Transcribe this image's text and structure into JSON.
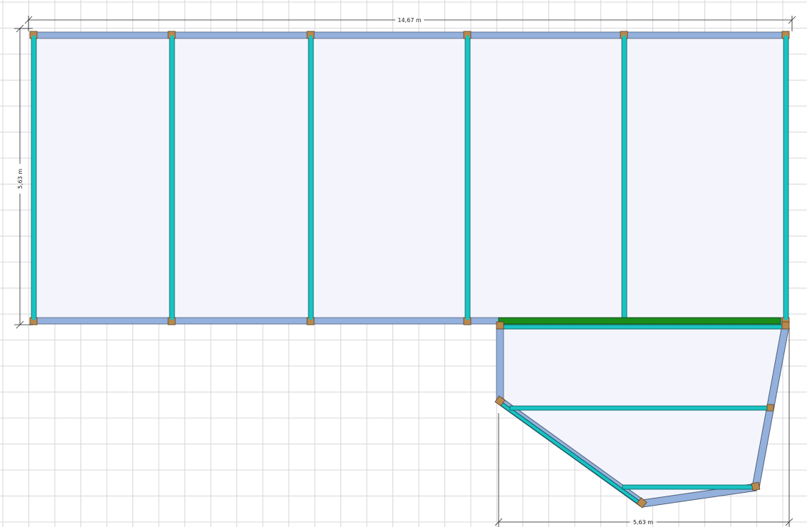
{
  "dimensions": {
    "top_width": "14,67 m",
    "left_height": "5,63 m",
    "bottom_width": "5,63 m"
  },
  "colors": {
    "grid_line": "#d7d7dc",
    "room_fill": "#f4f5fc",
    "beam_blue": "#94b0dc",
    "beam_stroke": "#50607a",
    "rafter_cyan": "#19c3c3",
    "rafter_stroke": "#0a5a5a",
    "post_brown": "#b8894e",
    "post_stroke": "#5a4020",
    "gutter_green": "#1b8c1b",
    "dimension_line": "#222222"
  }
}
